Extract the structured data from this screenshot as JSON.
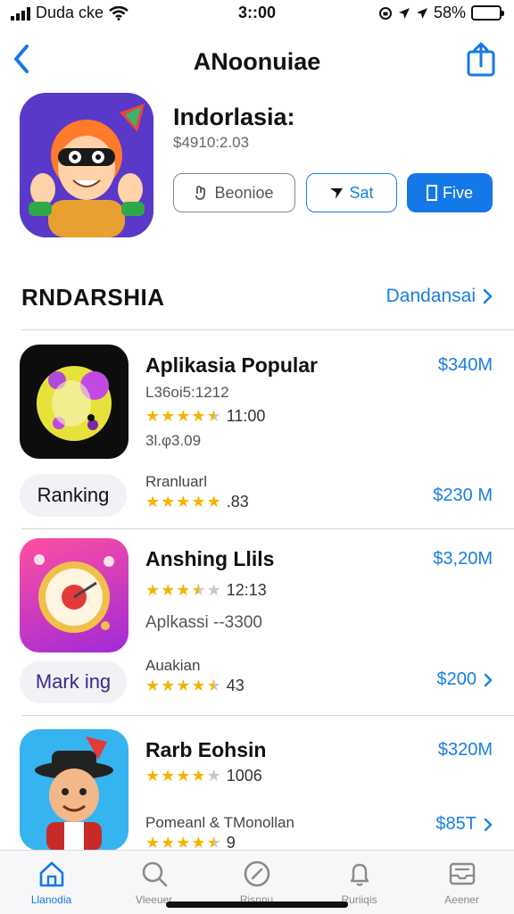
{
  "status_bar": {
    "carrier": "Duda cke",
    "time": "3::00",
    "battery": "58%",
    "battery_level": 0.58,
    "icons": [
      "signal-icon",
      "wifi-icon",
      "lock-rotation-icon",
      "location-icon",
      "location-icon",
      "battery-icon"
    ]
  },
  "nav": {
    "title": "ANoonuiae",
    "back_icon": "chevron-left-icon",
    "share_icon": "share-icon"
  },
  "hero": {
    "app_name": "Indorlasia:",
    "subtitle": "$4910:2.03",
    "buttons": {
      "secondary_label": "Beonioe",
      "outline_label": "Sat",
      "primary_label": "Five"
    }
  },
  "section": {
    "title": "RNDARSHIA",
    "link_label": "Dandansai"
  },
  "apps": [
    {
      "name": "Aplikasia Popular",
      "price": "$340M",
      "meta": "L36oi5:1212",
      "rating": 4.5,
      "rating_text": "11:00",
      "extra": "3l.φ3.09",
      "chip": "Ranking",
      "sub_label": "Rranluarl",
      "sub_rating": 5,
      "sub_rating_text": ".83",
      "sub_price": "$230 M",
      "sub_chevron": false
    },
    {
      "name": "Anshing Llils",
      "price": "$3,20M",
      "meta": "",
      "rating": 3.5,
      "rating_text": "12:13",
      "extra": "Aplkassi  --3300",
      "chip": "Mark ing",
      "sub_label": "Auakian",
      "sub_rating": 4.5,
      "sub_rating_text": "43",
      "sub_price": "$200",
      "sub_chevron": true
    },
    {
      "name": "Rarb Eohsin",
      "price": "$320M",
      "meta": "",
      "rating": 4,
      "rating_text": "1006",
      "extra": "",
      "chip": "",
      "sub_label": "Pomeanl & TMonollan",
      "sub_rating": 4.5,
      "sub_rating_text": "9",
      "sub_price": "$85T",
      "sub_chevron": true
    }
  ],
  "tabbar": {
    "tabs": [
      {
        "label": "Llanodia",
        "icon": "home-icon",
        "active": true
      },
      {
        "label": "Vleeuer",
        "icon": "search-icon",
        "active": false
      },
      {
        "label": "Risnnu",
        "icon": "compass-icon",
        "active": false
      },
      {
        "label": "Ruriiqis",
        "icon": "bell-icon",
        "active": false
      },
      {
        "label": "Aeener",
        "icon": "inbox-icon",
        "active": false
      }
    ]
  },
  "colors": {
    "accent": "#1478e8",
    "star": "#f4b400",
    "hero_icon_bg": "#5a38c8"
  }
}
